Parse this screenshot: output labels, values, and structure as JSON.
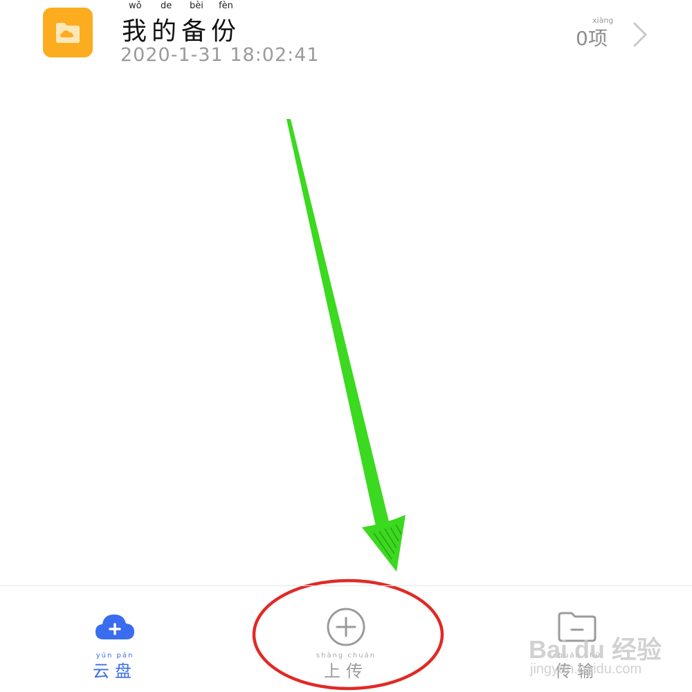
{
  "folder": {
    "icon": "cloud-folder-icon",
    "title": "我的备份",
    "title_pinyin": [
      "wǒ",
      "de",
      "bèi",
      "fèn"
    ],
    "date": "2020-1-31 18:02:41",
    "count": "0项",
    "count_pinyin": "xiàng",
    "chevron_icon": "chevron-right-icon",
    "accent": "#fbad1f"
  },
  "annotations": {
    "arrow_color": "#3bd91f",
    "circle_color": "#e02a26"
  },
  "bottom_nav": {
    "items": [
      {
        "label": "云盘",
        "pinyin": "yún pán",
        "icon": "cloud-plus-icon",
        "color": "#3a6cf0"
      },
      {
        "label": "上传",
        "pinyin": "shàng chuán",
        "icon": "plus-circle-icon",
        "color": "#9a9a9a"
      },
      {
        "label": "传输",
        "pinyin": "chuán shū",
        "icon": "transfer-folder-icon",
        "color": "#9a9a9a"
      }
    ]
  },
  "watermark": {
    "logo": "Bai du 经验",
    "url": "jingyan.baidu.com"
  }
}
